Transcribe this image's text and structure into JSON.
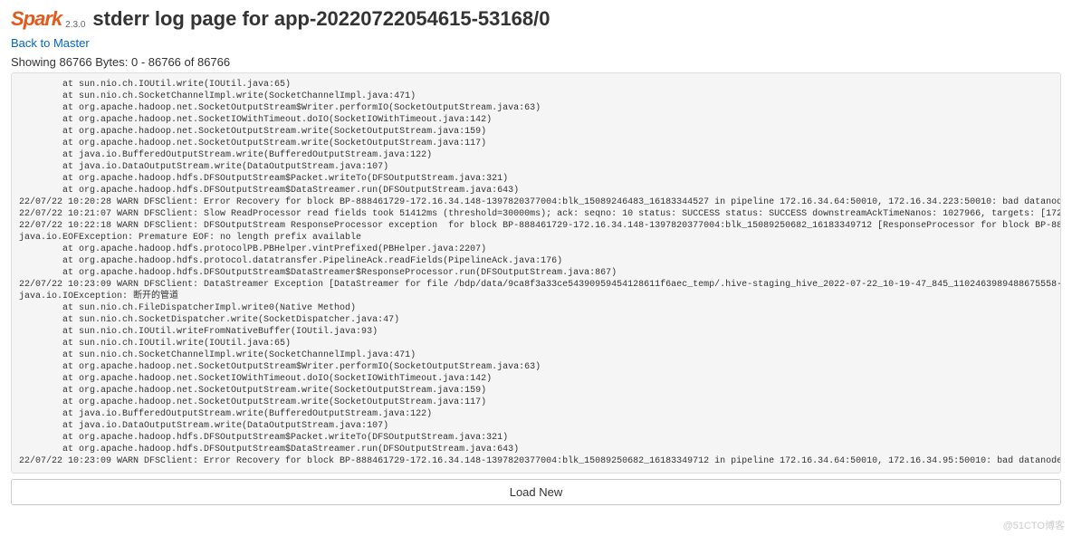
{
  "header": {
    "logo_text": "Spark",
    "version": "2.3.0",
    "title": "stderr log page for app-20220722054615-53168/0"
  },
  "nav": {
    "back_link": "Back to Master"
  },
  "bytes_info": "Showing 86766 Bytes: 0 - 86766 of 86766",
  "log_content": "        at sun.nio.ch.IOUtil.write(IOUtil.java:65)\n        at sun.nio.ch.SocketChannelImpl.write(SocketChannelImpl.java:471)\n        at org.apache.hadoop.net.SocketOutputStream$Writer.performIO(SocketOutputStream.java:63)\n        at org.apache.hadoop.net.SocketIOWithTimeout.doIO(SocketIOWithTimeout.java:142)\n        at org.apache.hadoop.net.SocketOutputStream.write(SocketOutputStream.java:159)\n        at org.apache.hadoop.net.SocketOutputStream.write(SocketOutputStream.java:117)\n        at java.io.BufferedOutputStream.write(BufferedOutputStream.java:122)\n        at java.io.DataOutputStream.write(DataOutputStream.java:107)\n        at org.apache.hadoop.hdfs.DFSOutputStream$Packet.writeTo(DFSOutputStream.java:321)\n        at org.apache.hadoop.hdfs.DFSOutputStream$DataStreamer.run(DFSOutputStream.java:643)\n22/07/22 10:20:28 WARN DFSClient: Error Recovery for block BP-888461729-172.16.34.148-1397820377004:blk_15089246483_16183344527 in pipeline 172.16.34.64:50010, 172.16.34.223:50010: bad datanode 172.16.34.64:50010 [DataStreamer for file /bdp/data/u9083189ae0349dbaf8f2f2ee3351579_temp/.hive-staging_hive_2022-07-22_10-16-47_909_6320972307505128897-167/-ext-10000/_temporary/0/_temporary/attempt_20220722101347_2794_m_000034_0/part-00034-c0b2f98a-7049-4a5d-bcf3-b3042cd16645-c000 block BP-888461729-172.16.34.148-1397820377004:blk_15089246483_16183344527]\n22/07/22 10:21:07 WARN DFSClient: Slow ReadProcessor read fields took 51412ms (threshold=30000ms); ack: seqno: 10 status: SUCCESS status: SUCCESS downstreamAckTimeNanos: 1027966, targets: [172.16.34.64:50010, 172.16.34.95:50010] [ResponseProcessor for block BP-888461729-172.16.34.148-1397820377004:blk_15089250682_16183349712]\n22/07/22 10:22:18 WARN DFSClient: DFSOutputStream ResponseProcessor exception  for block BP-888461729-172.16.34.148-1397820377004:blk_15089250682_16183349712 [ResponseProcessor for block BP-888461729-172.16.34.148-1397820377004:blk_15089250682_16183349712]\njava.io.EOFException: Premature EOF: no length prefix available\n        at org.apache.hadoop.hdfs.protocolPB.PBHelper.vintPrefixed(PBHelper.java:2207)\n        at org.apache.hadoop.hdfs.protocol.datatransfer.PipelineAck.readFields(PipelineAck.java:176)\n        at org.apache.hadoop.hdfs.DFSOutputStream$DataStreamer$ResponseProcessor.run(DFSOutputStream.java:867)\n22/07/22 10:23:09 WARN DFSClient: DataStreamer Exception [DataStreamer for file /bdp/data/9ca8f3a33ce54390959454128611f6aec_temp/.hive-staging_hive_2022-07-22_10-19-47_845_1102463989488675558-143/-ext-10000/_temporary/0/_temporary/attempt_20220722101658_2821_m_000049_0/part-00049-b0b65b5f-f8f0-4b60-9e72-04dde1343ede-c000 block BP-888461729-172.16.34.148-1397820377004:blk_15089250682_16183349712]\njava.io.IOException: 断开的管道\n        at sun.nio.ch.FileDispatcherImpl.write0(Native Method)\n        at sun.nio.ch.SocketDispatcher.write(SocketDispatcher.java:47)\n        at sun.nio.ch.IOUtil.writeFromNativeBuffer(IOUtil.java:93)\n        at sun.nio.ch.IOUtil.write(IOUtil.java:65)\n        at sun.nio.ch.SocketChannelImpl.write(SocketChannelImpl.java:471)\n        at org.apache.hadoop.net.SocketOutputStream$Writer.performIO(SocketOutputStream.java:63)\n        at org.apache.hadoop.net.SocketIOWithTimeout.doIO(SocketIOWithTimeout.java:142)\n        at org.apache.hadoop.net.SocketOutputStream.write(SocketOutputStream.java:159)\n        at org.apache.hadoop.net.SocketOutputStream.write(SocketOutputStream.java:117)\n        at java.io.BufferedOutputStream.write(BufferedOutputStream.java:122)\n        at java.io.DataOutputStream.write(DataOutputStream.java:107)\n        at org.apache.hadoop.hdfs.DFSOutputStream$Packet.writeTo(DFSOutputStream.java:321)\n        at org.apache.hadoop.hdfs.DFSOutputStream$DataStreamer.run(DFSOutputStream.java:643)\n22/07/22 10:23:09 WARN DFSClient: Error Recovery for block BP-888461729-172.16.34.148-1397820377004:blk_15089250682_16183349712 in pipeline 172.16.34.64:50010, 172.16.34.95:50010: bad datanode 172.16.34.64:50010 [DataStreamer for file /bdp/data/9ca8f3a33ce54390959454128611f6aec_temp/.hive-staging_hive_2022-07-22_10-19-47_845_1102463989488675558-143/-ext-10000/_temporary/0/_temporary/attempt_20220722101658_2821_m_000049_0/part-00049-b0b65b5f-f8f0-4b60-9e72-04dde1343ede-c000 block BP-888461729-172.16.34.148-1397820377004:blk_15089250682_16183349712]",
  "button": {
    "load_new": "Load New"
  },
  "watermark": "@51CTO博客"
}
